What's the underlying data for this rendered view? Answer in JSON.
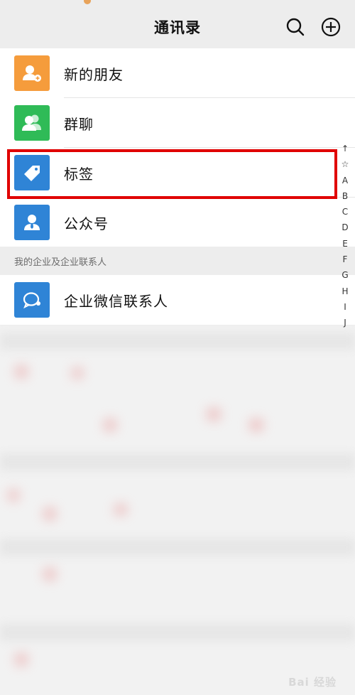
{
  "header": {
    "title": "通讯录"
  },
  "list_items": [
    {
      "label": "新的朋友",
      "icon": "add-friend-icon",
      "color": "#f59c3c"
    },
    {
      "label": "群聊",
      "icon": "group-chat-icon",
      "color": "#2fbb57"
    },
    {
      "label": "标签",
      "icon": "tag-icon",
      "color": "#2f84d6"
    },
    {
      "label": "公众号",
      "icon": "official-account-icon",
      "color": "#2f84d6"
    }
  ],
  "section": {
    "label": "我的企业及企业联系人"
  },
  "enterprise_item": {
    "label": "企业微信联系人",
    "icon": "enterprise-contact-icon",
    "color": "#2f84d6"
  },
  "alphabet_index": [
    "↑",
    "☆",
    "A",
    "B",
    "C",
    "D",
    "E",
    "F",
    "G",
    "H",
    "I",
    "J"
  ],
  "watermark": "Bai 经验",
  "highlight_color": "#e00000"
}
